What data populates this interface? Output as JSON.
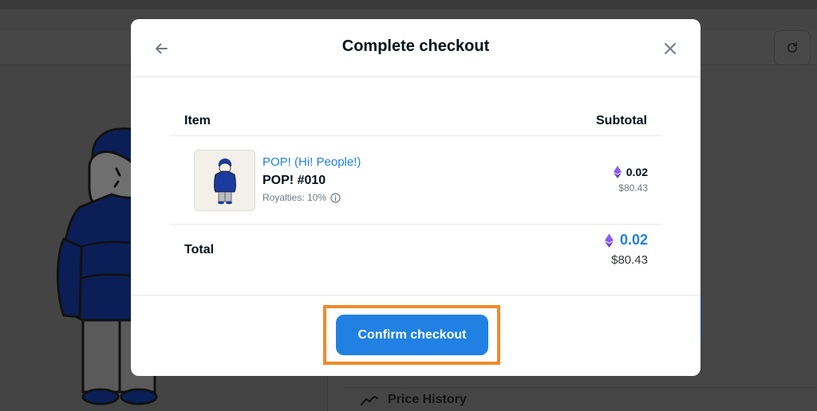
{
  "colors": {
    "accent": "#2081e2",
    "highlight": "#f08a2c",
    "overlay": "#444444",
    "text": "#04111d",
    "muted": "#707a83",
    "eth_icon": "#8a5cf6"
  },
  "modal": {
    "title": "Complete checkout",
    "back_icon": "arrow-left-icon",
    "close_icon": "close-icon"
  },
  "table": {
    "columns": [
      "Item",
      "Subtotal"
    ]
  },
  "item": {
    "collection": "POP! (Hi! People!)",
    "name": "POP! #010",
    "royalties": "Royalties: 10%",
    "price_eth": "0.02",
    "price_usd": "$80.43"
  },
  "total": {
    "label": "Total",
    "eth": "0.02",
    "usd": "$80.43"
  },
  "actions": {
    "confirm_label": "Confirm checkout"
  },
  "background": {
    "price_history_label": "Price History"
  }
}
